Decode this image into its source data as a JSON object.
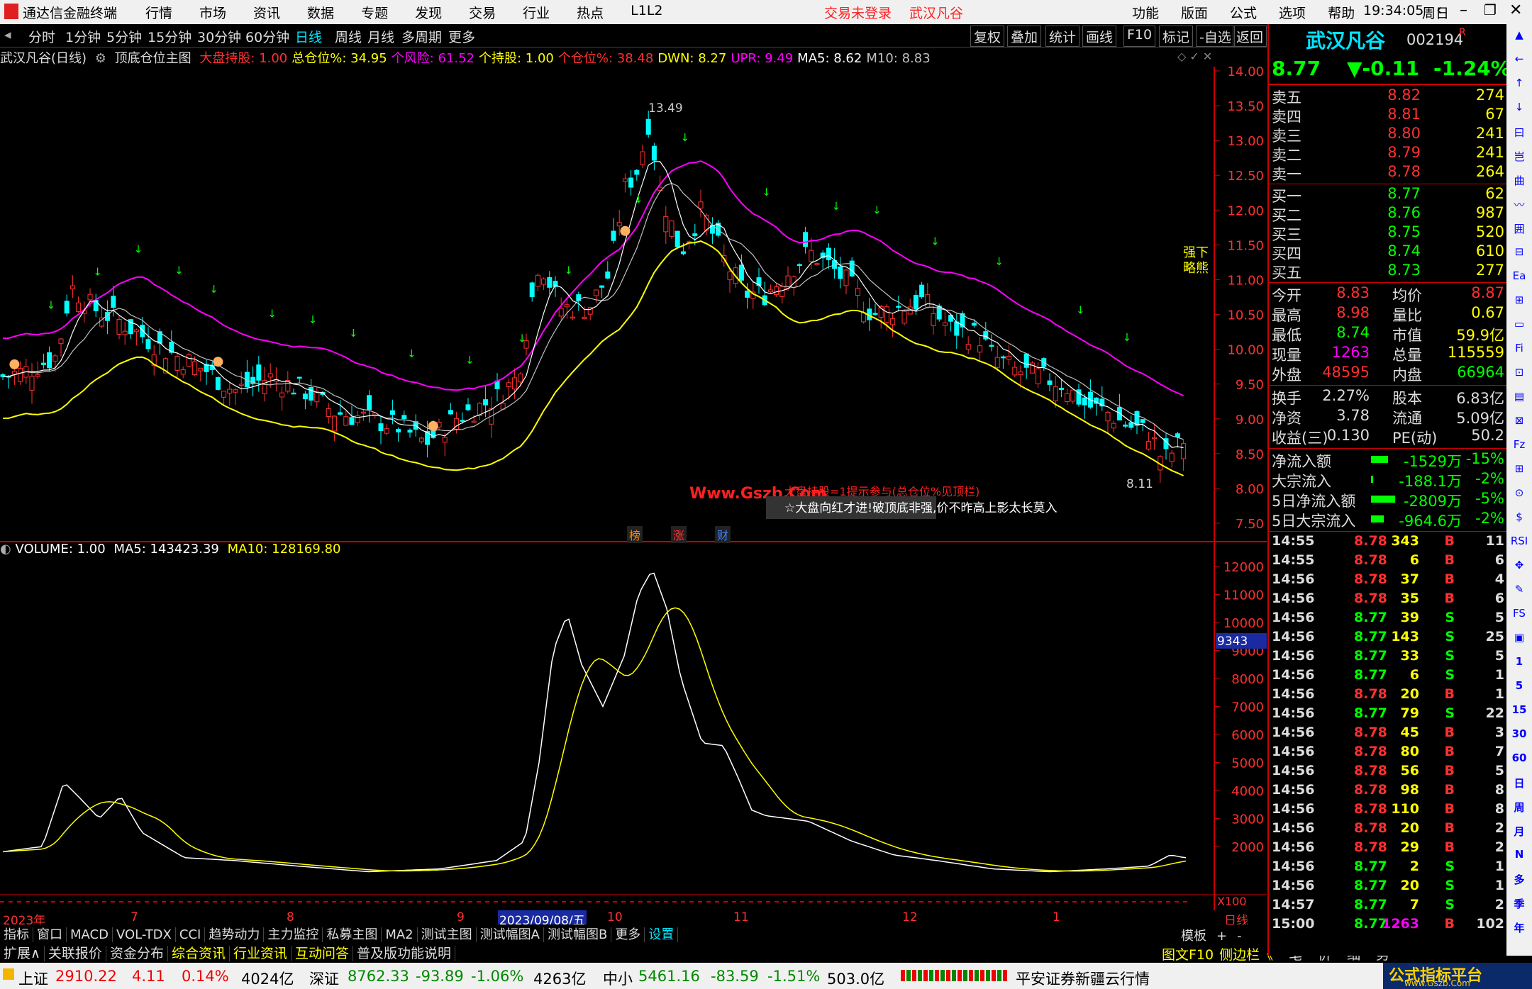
{
  "titlebar": {
    "app": "通达信金融终端",
    "menu": [
      "行情",
      "市场",
      "资讯",
      "数据",
      "专题",
      "发现",
      "交易",
      "行业",
      "热点",
      "L1L2"
    ],
    "login": "交易未登录",
    "stock": "武汉凡谷",
    "rmenu": [
      "功能",
      "版面",
      "公式",
      "选项",
      "帮助"
    ],
    "time": "19:34:05",
    "weekday": "周日"
  },
  "periods": [
    "分时",
    "1分钟",
    "5分钟",
    "15分钟",
    "30分钟",
    "60分钟",
    "日线",
    "周线",
    "月线",
    "多周期",
    "更多"
  ],
  "selected_period": "日线",
  "tools": [
    "复权",
    "叠加",
    "统计",
    "画线",
    "F10",
    "标记",
    "-自选",
    "返回"
  ],
  "indicator_header": {
    "name": "武汉凡谷(日线)",
    "formula": "顶底仓位主图",
    "items": [
      {
        "label": "大盘持股: 1.00",
        "color": "#ff3030"
      },
      {
        "label": "总仓位%: 34.95",
        "color": "#ffff00"
      },
      {
        "label": "个风险: 61.52",
        "color": "#ff00ff"
      },
      {
        "label": "个持股: 1.00",
        "color": "#ffff00"
      },
      {
        "label": "个仓位%: 38.48",
        "color": "#ff3030"
      },
      {
        "label": "DWN: 8.27",
        "color": "#ffff00"
      },
      {
        "label": "UPR: 9.49",
        "color": "#ff00ff"
      },
      {
        "label": "MA5: 8.62",
        "color": "#ffffff"
      },
      {
        "label": "M10: 8.83",
        "color": "#c0c0c0"
      }
    ]
  },
  "price_axis": [
    "14.00",
    "13.50",
    "13.00",
    "12.50",
    "12.00",
    "11.50",
    "11.00",
    "10.50",
    "10.00",
    "9.50",
    "9.00",
    "8.50",
    "8.00",
    "7.50"
  ],
  "vol_axis": [
    "12000",
    "11000",
    "10000",
    "9000",
    "8000",
    "7000",
    "6000",
    "5000",
    "4000",
    "3000",
    "2000"
  ],
  "vol_marker": "9343",
  "vol_unit": "X100",
  "volume_header": {
    "label": "VOLUME: 1.00",
    "ma5": "MA5: 143423.39",
    "ma10": "MA10: 128169.80"
  },
  "annotations": {
    "high": "13.49",
    "low": "8.11",
    "side_text": "强下\n略熊",
    "watermark": "Www.Gszb.Com",
    "red_tip": "大盘持股=1提示参与(总仓位%见顶栏)",
    "white_tip": "☆大盘向红才进!破顶底非强,价不昨高上影太长莫入",
    "badges": [
      "榜",
      "涨",
      "财"
    ]
  },
  "date_axis": [
    "2023年",
    "7",
    "8",
    "9",
    "2023/09/08/五",
    "10",
    "11",
    "12",
    "1",
    "日线"
  ],
  "tab_row1": [
    "指标",
    "窗口",
    "MACD",
    "VOL-TDX",
    "CCI",
    "趋势动力",
    "主力监控",
    "私募主图",
    "MA2",
    "测试主图",
    "测试幅图A",
    "测试幅图B",
    "更多",
    "设置"
  ],
  "tab_row1_right": [
    "模板",
    "+",
    "-"
  ],
  "tab_row2": [
    "扩展∧",
    "关联报价",
    "资金分布",
    "综合资讯",
    "行业资讯",
    "互动问答",
    "普及版功能说明"
  ],
  "tab_row2_right": [
    "图文F10",
    "侧边栏《",
    "笔",
    "价",
    "细",
    "势"
  ],
  "quote": {
    "name": "武汉凡谷",
    "code": "002194",
    "flag": "R",
    "price": "8.77",
    "change": "▼-0.11",
    "pct": "-1.24%",
    "asks": [
      {
        "label": "卖五",
        "price": "8.82",
        "vol": "274"
      },
      {
        "label": "卖四",
        "price": "8.81",
        "vol": "67"
      },
      {
        "label": "卖三",
        "price": "8.80",
        "vol": "241"
      },
      {
        "label": "卖二",
        "price": "8.79",
        "vol": "241"
      },
      {
        "label": "卖一",
        "price": "8.78",
        "vol": "264"
      }
    ],
    "bids": [
      {
        "label": "买一",
        "price": "8.77",
        "vol": "62"
      },
      {
        "label": "买二",
        "price": "8.76",
        "vol": "987"
      },
      {
        "label": "买三",
        "price": "8.75",
        "vol": "520"
      },
      {
        "label": "买四",
        "price": "8.74",
        "vol": "610"
      },
      {
        "label": "买五",
        "price": "8.73",
        "vol": "277"
      }
    ],
    "stats": [
      {
        "l1": "今开",
        "v1": "8.83",
        "c1": "#ff3030",
        "l2": "均价",
        "v2": "8.87",
        "c2": "#ff3030"
      },
      {
        "l1": "最高",
        "v1": "8.98",
        "c1": "#ff3030",
        "l2": "量比",
        "v2": "0.67",
        "c2": "#ffff00"
      },
      {
        "l1": "最低",
        "v1": "8.74",
        "c1": "#00ff00",
        "l2": "市值",
        "v2": "59.9亿",
        "c2": "#ffff00"
      },
      {
        "l1": "现量",
        "v1": "1263",
        "c1": "#ff00ff",
        "l2": "总量",
        "v2": "115559",
        "c2": "#ffff00"
      },
      {
        "l1": "外盘",
        "v1": "48595",
        "c1": "#ff3030",
        "l2": "内盘",
        "v2": "66964",
        "c2": "#00ff00"
      }
    ],
    "stats2": [
      {
        "l1": "换手",
        "v1": "2.27%",
        "l2": "股本",
        "v2": "6.83亿"
      },
      {
        "l1": "净资",
        "v1": "3.78",
        "l2": "流通",
        "v2": "5.09亿"
      },
      {
        "l1": "收益(三)",
        "v1": "0.130",
        "l2": "PE(动)",
        "v2": "50.2"
      }
    ],
    "flows": [
      {
        "label": "净流入额",
        "value": "-1529万",
        "pct": "-15%"
      },
      {
        "label": "大宗流入",
        "value": "-188.1万",
        "pct": "-2%"
      },
      {
        "label": "5日净流入额",
        "value": "-2809万",
        "pct": "-5%"
      },
      {
        "label": "5日大宗流入",
        "value": "-964.6万",
        "pct": "-2%"
      }
    ],
    "ticks": [
      {
        "t": "14:55",
        "p": "8.78",
        "v": "343",
        "d": "B",
        "n": "11"
      },
      {
        "t": "14:55",
        "p": "8.78",
        "v": "6",
        "d": "B",
        "n": "6"
      },
      {
        "t": "14:56",
        "p": "8.78",
        "v": "37",
        "d": "B",
        "n": "4"
      },
      {
        "t": "14:56",
        "p": "8.78",
        "v": "35",
        "d": "B",
        "n": "6"
      },
      {
        "t": "14:56",
        "p": "8.77",
        "v": "39",
        "d": "S",
        "n": "5"
      },
      {
        "t": "14:56",
        "p": "8.77",
        "v": "143",
        "d": "S",
        "n": "25"
      },
      {
        "t": "14:56",
        "p": "8.77",
        "v": "33",
        "d": "S",
        "n": "5"
      },
      {
        "t": "14:56",
        "p": "8.77",
        "v": "6",
        "d": "S",
        "n": "1"
      },
      {
        "t": "14:56",
        "p": "8.78",
        "v": "20",
        "d": "B",
        "n": "1"
      },
      {
        "t": "14:56",
        "p": "8.77",
        "v": "79",
        "d": "S",
        "n": "22"
      },
      {
        "t": "14:56",
        "p": "8.78",
        "v": "45",
        "d": "B",
        "n": "3"
      },
      {
        "t": "14:56",
        "p": "8.78",
        "v": "80",
        "d": "B",
        "n": "7"
      },
      {
        "t": "14:56",
        "p": "8.78",
        "v": "56",
        "d": "B",
        "n": "5"
      },
      {
        "t": "14:56",
        "p": "8.78",
        "v": "98",
        "d": "B",
        "n": "8"
      },
      {
        "t": "14:56",
        "p": "8.78",
        "v": "110",
        "d": "B",
        "n": "8"
      },
      {
        "t": "14:56",
        "p": "8.78",
        "v": "20",
        "d": "B",
        "n": "2"
      },
      {
        "t": "14:56",
        "p": "8.78",
        "v": "29",
        "d": "B",
        "n": "2"
      },
      {
        "t": "14:56",
        "p": "8.77",
        "v": "2",
        "d": "S",
        "n": "1"
      },
      {
        "t": "14:56",
        "p": "8.77",
        "v": "20",
        "d": "S",
        "n": "1"
      },
      {
        "t": "14:57",
        "p": "8.77",
        "v": "7",
        "d": "S",
        "n": "2"
      },
      {
        "t": "15:00",
        "p": "8.77",
        "v": "1263",
        "d": "B",
        "n": "102"
      }
    ]
  },
  "side_icons": [
    "▲",
    "←",
    "↑",
    "↓",
    "曰",
    "岂",
    "曲",
    "〰",
    "囲",
    "⊟",
    "Ea",
    "⊞",
    "▭",
    "Fi",
    "⊡",
    "▤",
    "⊠",
    "Fz",
    "⊞",
    "⊙",
    "$",
    "RSI",
    "✥",
    "✎",
    "FS",
    "▣",
    "1",
    "5",
    "15",
    "30",
    "60",
    "日",
    "周",
    "月",
    "N",
    "多",
    "季",
    "年"
  ],
  "statusbar": {
    "sh_label": "上证",
    "sh_val": "2910.22",
    "sh_chg": "4.11",
    "sh_pct": "0.14%",
    "sh_amt": "4024亿",
    "sz_label": "深证",
    "sz_val": "8762.33",
    "sz_chg": "-93.89",
    "sz_pct": "-1.06%",
    "sz_amt": "4263亿",
    "zx_label": "中小",
    "zx_val": "5461.16",
    "zx_chg": "-83.59",
    "zx_pct": "-1.51%",
    "zx_amt": "503.0亿",
    "broker": "平安证券新疆云行情",
    "brand": "公式指标平台",
    "brand_url": "www.Gszb.Com"
  },
  "colors": {
    "up": "#ff3030",
    "down": "#00ffff",
    "ma5": "#ffffff",
    "ma10": "#c0c0c0",
    "upr": "#ff00ff",
    "dwn": "#ffff00",
    "vol": "#ffffff",
    "vol_ma": "#ffff00"
  }
}
